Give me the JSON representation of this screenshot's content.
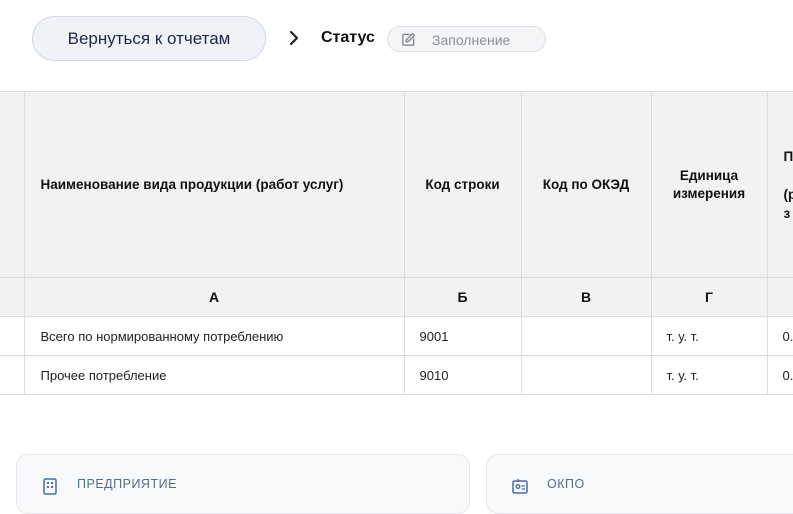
{
  "header": {
    "back_label": "Вернуться к отчетам",
    "status_label": "Статус",
    "status_value": "Заполнение"
  },
  "table": {
    "columns": [
      {
        "title": "Наименование вида продукции (работ услуг)",
        "letter": "А"
      },
      {
        "title": "Код строки",
        "letter": "Б"
      },
      {
        "title": "Код по ОКЭД",
        "letter": "В"
      },
      {
        "title": "Единица измерения",
        "letter": "Г"
      },
      {
        "title_lines": [
          "П",
          "(р",
          "з"
        ],
        "letter": ""
      }
    ],
    "rows": [
      {
        "name": "Всего по нормированному потреблению",
        "code": "9001",
        "okved": "",
        "unit": "т. у. т.",
        "next": "0."
      },
      {
        "name": "Прочее потребление",
        "code": "9010",
        "okved": "",
        "unit": "т. у. т.",
        "next": "0."
      }
    ]
  },
  "cards": [
    {
      "label": "ПРЕДПРИЯТИЕ",
      "icon": "building-icon"
    },
    {
      "label": "ОКПО",
      "icon": "id-card-icon"
    }
  ]
}
